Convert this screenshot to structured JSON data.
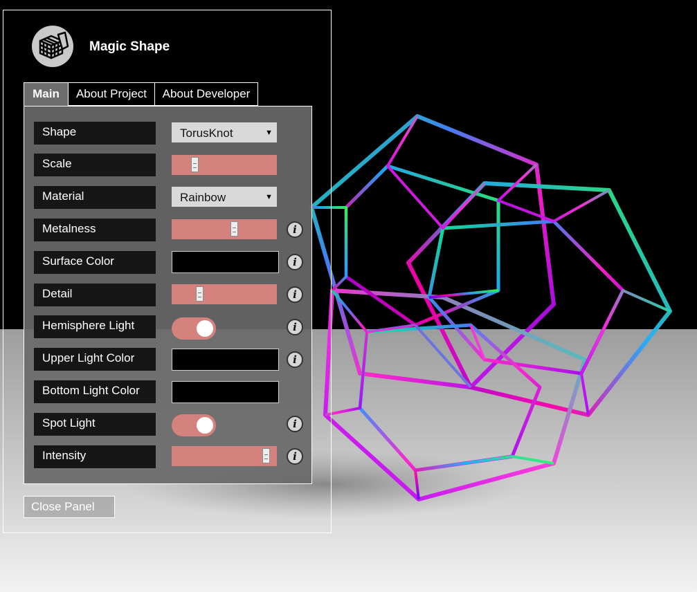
{
  "app": {
    "title": "Magic Shape"
  },
  "tabs": [
    {
      "label": "Main"
    },
    {
      "label": "About Project"
    },
    {
      "label": "About Developer"
    }
  ],
  "controls": {
    "shape": {
      "label": "Shape",
      "value": "TorusKnot"
    },
    "scale": {
      "label": "Scale",
      "value_fraction": 0.2
    },
    "material": {
      "label": "Material",
      "value": "Rainbow"
    },
    "metalness": {
      "label": "Metalness",
      "value_fraction": 0.6
    },
    "surface_color": {
      "label": "Surface Color",
      "value": "#000000"
    },
    "detail": {
      "label": "Detail",
      "value_fraction": 0.25
    },
    "hemisphere_light": {
      "label": "Hemisphere Light",
      "on": true
    },
    "upper_light_color": {
      "label": "Upper Light Color",
      "value": "#000000"
    },
    "bottom_light_color": {
      "label": "Bottom Light Color",
      "value": "#000000"
    },
    "spot_light": {
      "label": "Spot Light",
      "on": true
    },
    "intensity": {
      "label": "Intensity",
      "value_fraction": 0.93
    }
  },
  "close_button": {
    "label": "Close Panel"
  },
  "colors": {
    "slider_track": "#d3827e",
    "panel_bg": "#696969",
    "label_bg": "#161616"
  }
}
